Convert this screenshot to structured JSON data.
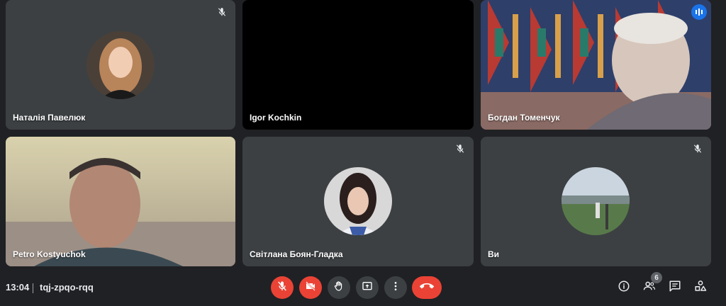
{
  "participants": [
    {
      "name": "Наталія Павелюк",
      "muted": true
    },
    {
      "name": "Igor Kochkin",
      "muted": false
    },
    {
      "name": "Богдан Томенчук",
      "speaking": true
    },
    {
      "name": "Petro Kostyuchok",
      "muted": false
    },
    {
      "name": "Світлана Боян-Гладка",
      "muted": true
    },
    {
      "name": "Ви",
      "muted": true
    }
  ],
  "meeting": {
    "time": "13:04",
    "code": "tqj-zpqo-rqq",
    "participant_count": "6"
  },
  "controls": {
    "mic": {
      "icon": "mic-off-icon",
      "state": "off"
    },
    "camera": {
      "icon": "videocam-off-icon",
      "state": "off"
    },
    "hand": {
      "icon": "raise-hand-icon"
    },
    "present": {
      "icon": "present-screen-icon"
    },
    "more": {
      "icon": "more-vert-icon"
    },
    "leave": {
      "icon": "call-end-icon"
    }
  },
  "right_controls": [
    "info-icon",
    "people-icon",
    "chat-icon",
    "activities-icon"
  ],
  "colors": {
    "background": "#202124",
    "tile": "#3c4043",
    "red": "#ea4335",
    "accent": "#8ab4f8"
  }
}
